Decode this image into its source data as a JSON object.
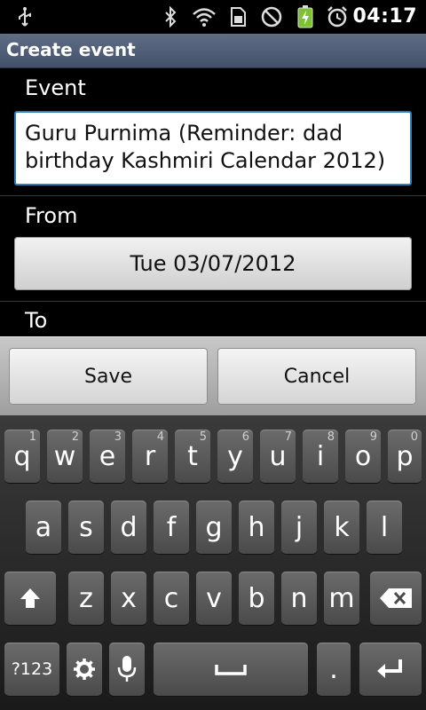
{
  "status_bar": {
    "time": "04:17",
    "icons": [
      "usb-icon",
      "bluetooth-icon",
      "wifi-icon",
      "sim-card-icon",
      "no-sound-icon",
      "battery-charging-icon",
      "alarm-clock-icon"
    ]
  },
  "title_bar": {
    "title": "Create event"
  },
  "form": {
    "event_label": "Event",
    "event_value": "Guru Purnima (Reminder: dad birthday  Kashmiri Calendar 2012)",
    "from_label": "From",
    "from_date": "Tue 03/07/2012",
    "to_label": "To"
  },
  "actions": {
    "save": "Save",
    "cancel": "Cancel"
  },
  "keyboard": {
    "row1": [
      {
        "key": "q",
        "hint": "1"
      },
      {
        "key": "w",
        "hint": "2"
      },
      {
        "key": "e",
        "hint": "3"
      },
      {
        "key": "r",
        "hint": "4"
      },
      {
        "key": "t",
        "hint": "5"
      },
      {
        "key": "y",
        "hint": "6"
      },
      {
        "key": "u",
        "hint": "7"
      },
      {
        "key": "i",
        "hint": "8"
      },
      {
        "key": "o",
        "hint": "9"
      },
      {
        "key": "p",
        "hint": "0"
      }
    ],
    "row2": [
      "a",
      "s",
      "d",
      "f",
      "g",
      "h",
      "j",
      "k",
      "l"
    ],
    "row3": [
      "z",
      "x",
      "c",
      "v",
      "b",
      "n",
      "m"
    ],
    "symbols_label": "?123",
    "period": "."
  },
  "colors": {
    "title_bar": "#4f5c75",
    "input_border": "#2e7fb5"
  }
}
